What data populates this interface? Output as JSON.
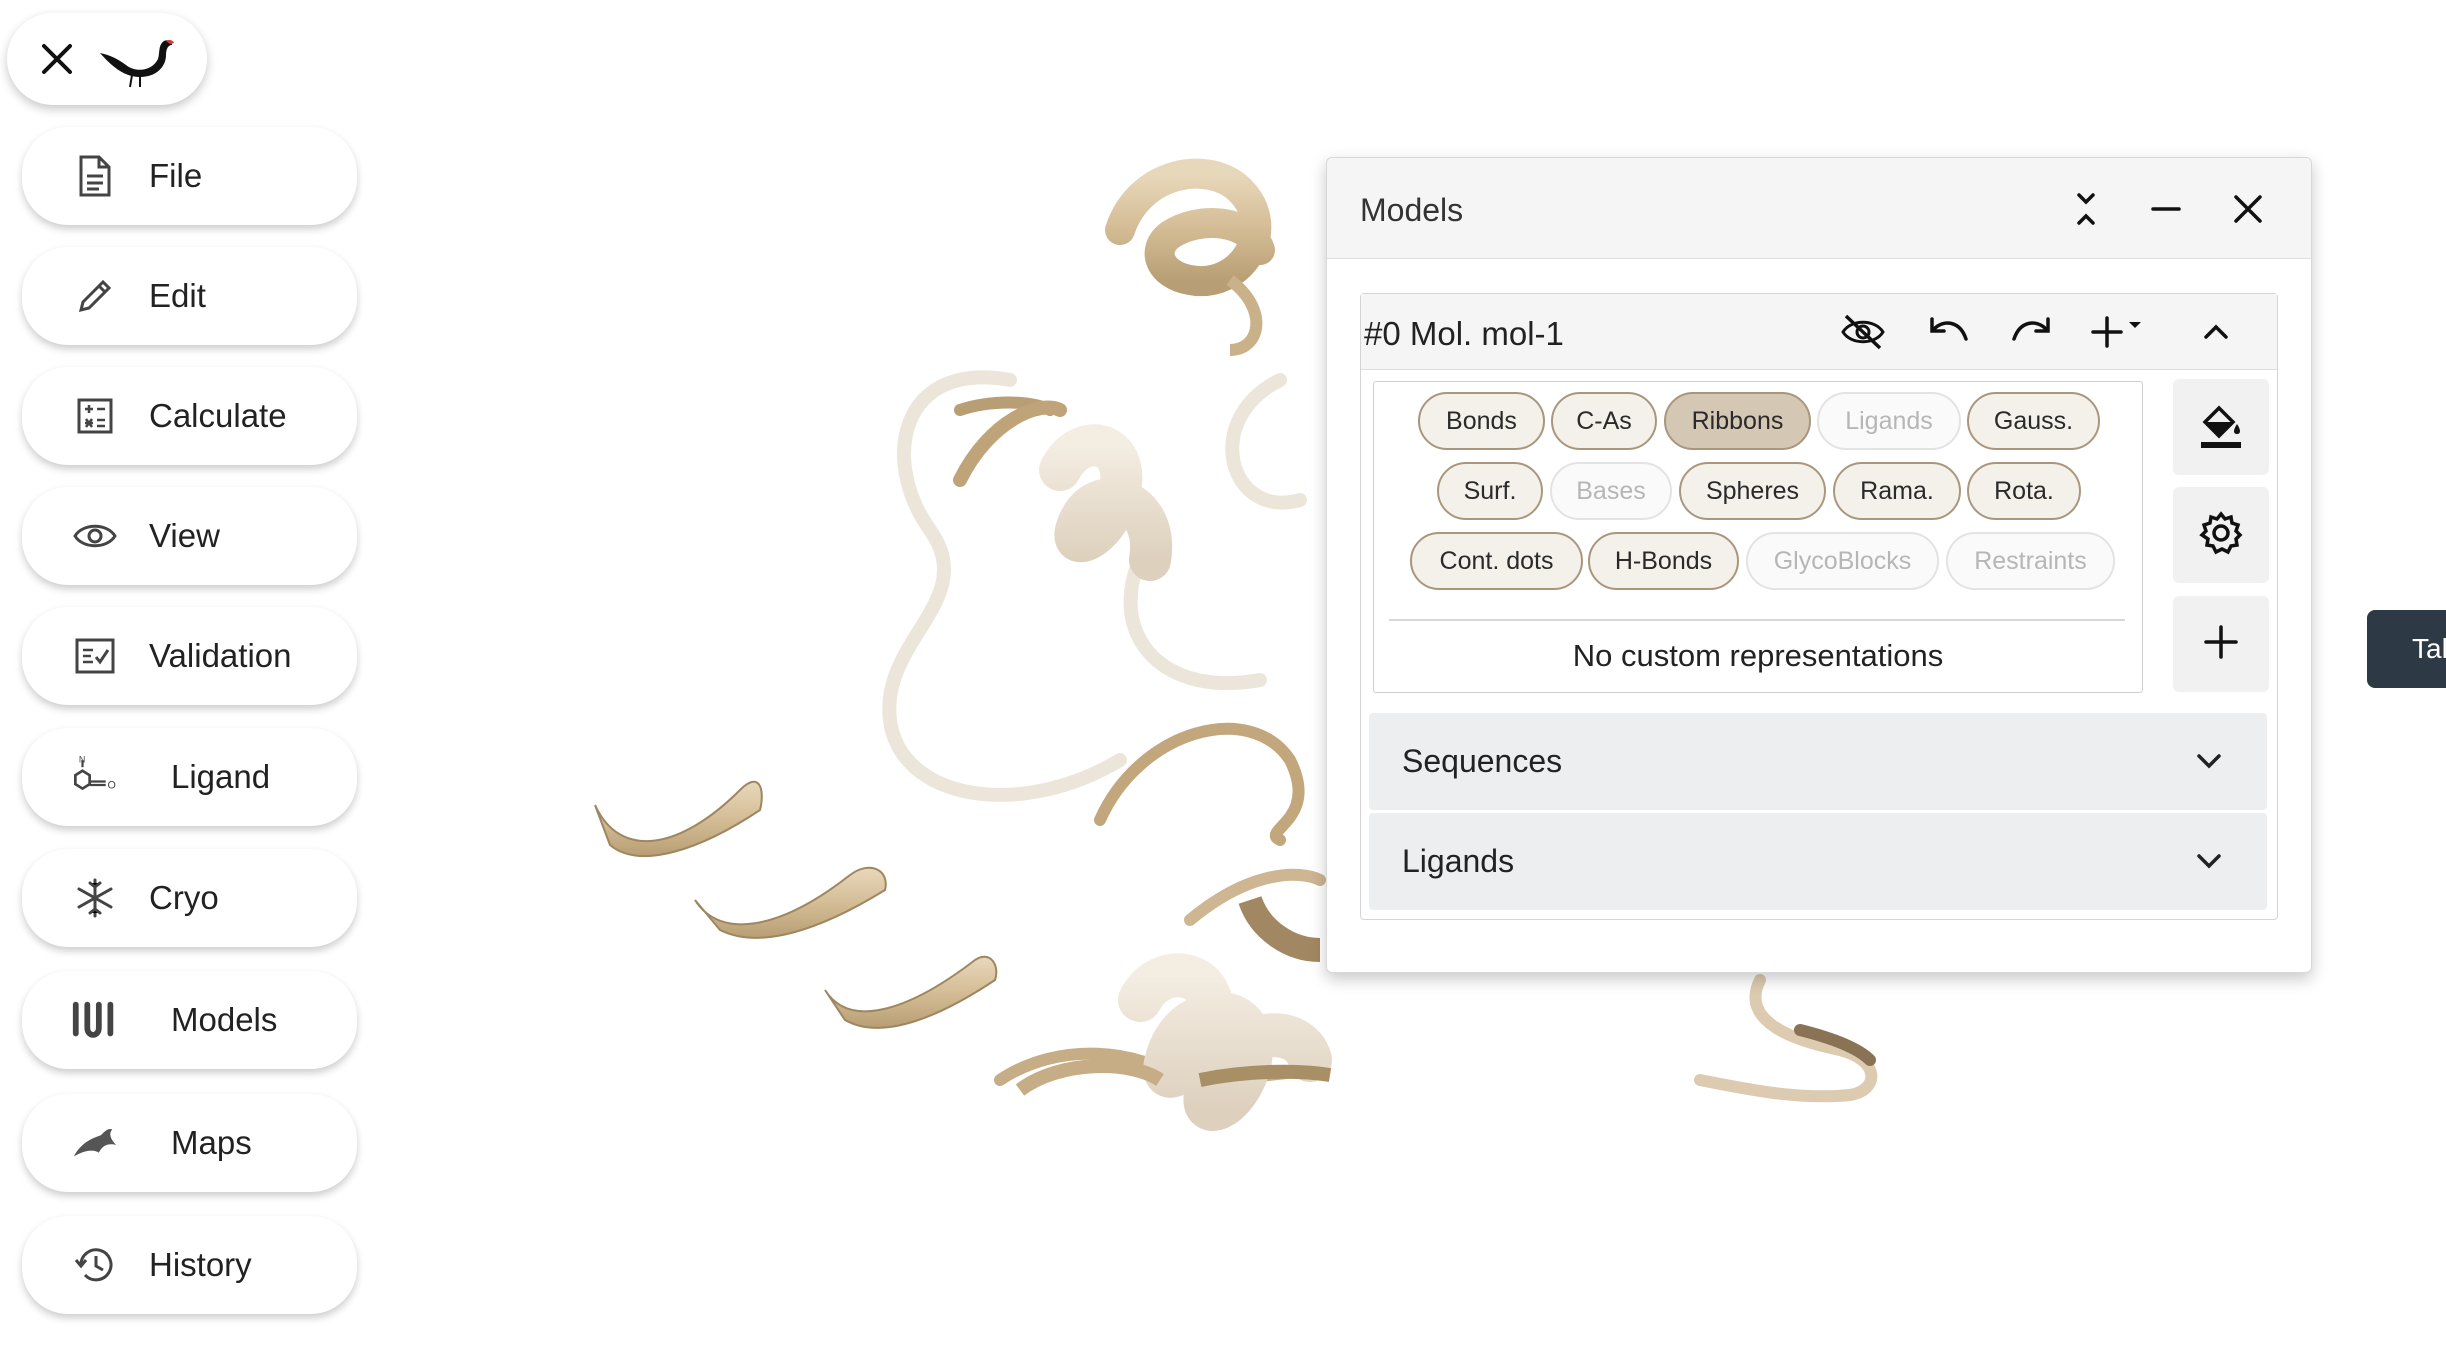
{
  "app": {
    "close_icon": "close-icon",
    "logo": "moorhen-bird-logo"
  },
  "sidebar": {
    "items": [
      {
        "label": "File",
        "icon": "file-icon"
      },
      {
        "label": "Edit",
        "icon": "pencil-icon"
      },
      {
        "label": "Calculate",
        "icon": "calculator-icon"
      },
      {
        "label": "View",
        "icon": "eye-icon"
      },
      {
        "label": "Validation",
        "icon": "checklist-icon"
      },
      {
        "label": "Ligand",
        "icon": "ligand-icon"
      },
      {
        "label": "Cryo",
        "icon": "snowflake-icon"
      },
      {
        "label": "Models",
        "icon": "models-icon"
      },
      {
        "label": "Maps",
        "icon": "maps-icon"
      },
      {
        "label": "History",
        "icon": "history-icon"
      }
    ]
  },
  "models_panel": {
    "title": "Models",
    "molecule": {
      "name": "#0 Mol. mol-1",
      "representations": [
        {
          "label": "Bonds",
          "state": "available"
        },
        {
          "label": "C-As",
          "state": "available"
        },
        {
          "label": "Ribbons",
          "state": "active"
        },
        {
          "label": "Ligands",
          "state": "disabled"
        },
        {
          "label": "Gauss.",
          "state": "available"
        },
        {
          "label": "Surf.",
          "state": "available"
        },
        {
          "label": "Bases",
          "state": "disabled"
        },
        {
          "label": "Spheres",
          "state": "available"
        },
        {
          "label": "Rama.",
          "state": "available"
        },
        {
          "label": "Rota.",
          "state": "available"
        },
        {
          "label": "Cont. dots",
          "state": "available"
        },
        {
          "label": "H-Bonds",
          "state": "available"
        },
        {
          "label": "GlycoBlocks",
          "state": "disabled"
        },
        {
          "label": "Restraints",
          "state": "disabled"
        }
      ],
      "no_custom_text": "No custom representations"
    },
    "accordions": [
      {
        "label": "Sequences"
      },
      {
        "label": "Ligands"
      }
    ]
  },
  "right_tab": {
    "label": "Tal"
  },
  "colors": {
    "ribbon": "#d8c4a2",
    "chip_border": "#a8977c",
    "chip_active": "#d4c7b4",
    "tab_bg": "#2d3a45"
  }
}
